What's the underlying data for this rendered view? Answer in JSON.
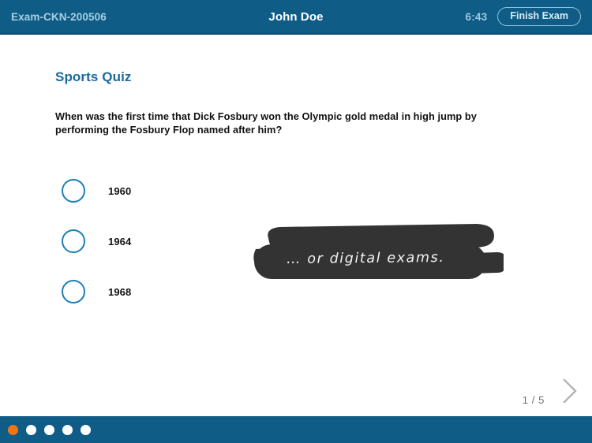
{
  "header": {
    "exam_id": "Exam-CKN-200506",
    "student_name": "John Doe",
    "timer": "6:43",
    "finish_label": "Finish Exam",
    "bg_color": "#0f5c86"
  },
  "quiz": {
    "title": "Sports Quiz",
    "question": "When was the first time that Dick Fosbury won the Olympic gold medal in high jump by performing the Fosbury Flop named after him?",
    "title_color": "#1b6a9c",
    "options": [
      {
        "label": "1960",
        "selected": false
      },
      {
        "label": "1964",
        "selected": false
      },
      {
        "label": "1968",
        "selected": false
      }
    ]
  },
  "annotation": {
    "text": "… or digital exams.",
    "stroke_color": "#333333",
    "text_color": "#f4f4f4"
  },
  "navigation": {
    "next_icon": "chevron-right-icon",
    "page_indicator": "1 / 5"
  },
  "footer": {
    "active_color": "#ee7513",
    "inactive_color": "#ffffff",
    "dots": [
      {
        "index": 1,
        "active": true
      },
      {
        "index": 2,
        "active": false
      },
      {
        "index": 3,
        "active": false
      },
      {
        "index": 4,
        "active": false
      },
      {
        "index": 5,
        "active": false
      }
    ]
  }
}
